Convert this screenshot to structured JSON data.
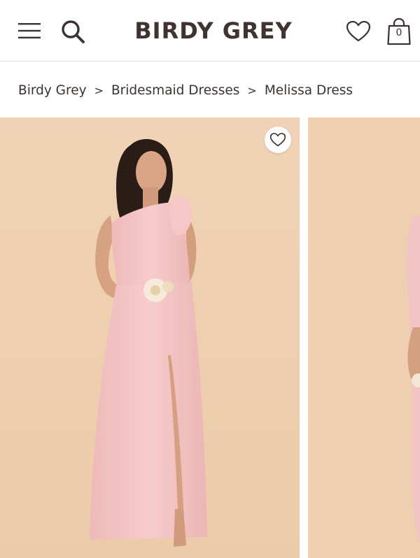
{
  "header": {
    "logo": "BIRDY GREY",
    "menu_icon": "hamburger-menu-icon",
    "search_icon": "search-icon",
    "wishlist_icon": "heart-icon",
    "bag_icon": "shopping-bag-icon",
    "bag_count": "0"
  },
  "breadcrumb": [
    {
      "label": "Birdy Grey"
    },
    {
      "label": "Bridesmaid Dresses"
    },
    {
      "label": "Melissa Dress"
    }
  ],
  "breadcrumb_separator": ">",
  "gallery": {
    "background_color": "#efd2b4",
    "dress_color": "#f4c6c6",
    "favorite_icon": "heart-icon"
  }
}
